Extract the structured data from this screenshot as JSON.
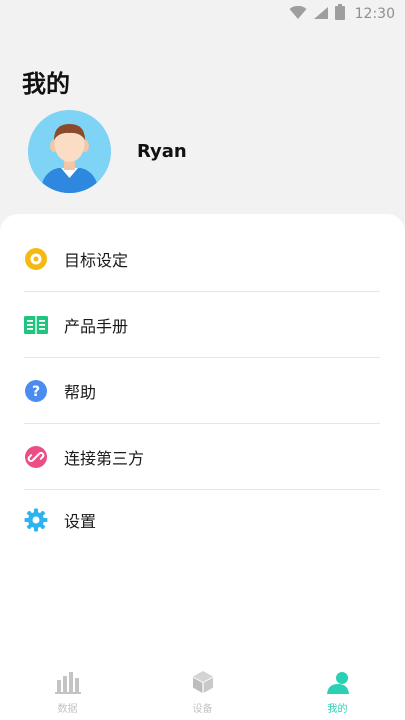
{
  "status_bar": {
    "time": "12:30",
    "icons": [
      "wifi-icon",
      "cell-signal-icon",
      "battery-icon"
    ]
  },
  "page": {
    "title": "我的"
  },
  "profile": {
    "name": "Ryan",
    "avatar": "avatar-illustration"
  },
  "menu": [
    {
      "label": "目标设定",
      "icon": "target-icon",
      "color": "#f5b914"
    },
    {
      "label": "产品手册",
      "icon": "book-icon",
      "color": "#1fc47e"
    },
    {
      "label": "帮助",
      "icon": "help-icon",
      "color": "#4a8cf0"
    },
    {
      "label": "连接第三方",
      "icon": "link-icon",
      "color": "#ec4d84"
    },
    {
      "label": "设置",
      "icon": "gear-icon",
      "color": "#2bb4f0"
    }
  ],
  "tabbar": {
    "tabs": [
      {
        "label": "数据",
        "icon": "bar-chart-icon",
        "active": false
      },
      {
        "label": "设备",
        "icon": "cube-icon",
        "active": false
      },
      {
        "label": "我的",
        "icon": "person-icon",
        "active": true
      }
    ],
    "active_color": "#2ad0b3",
    "inactive_color": "#c4c4c4"
  }
}
